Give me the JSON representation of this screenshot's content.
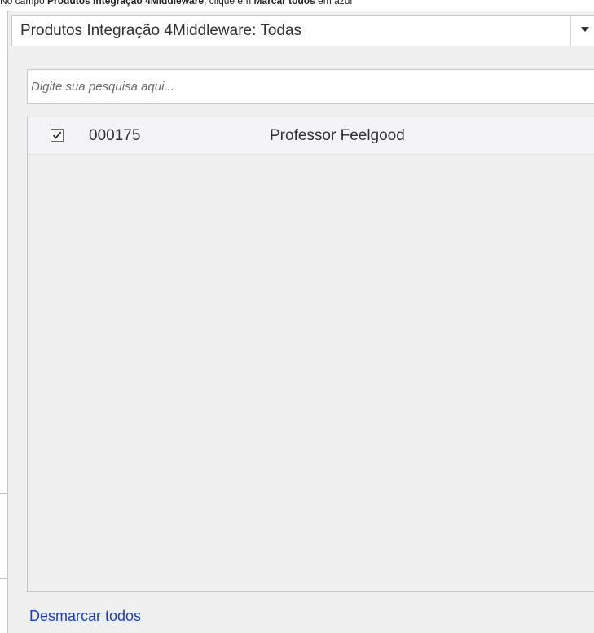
{
  "instruction": {
    "prefix": "No campo ",
    "field_bold": "Produtos Integração 4Middleware",
    "middle": ", clique em ",
    "action_bold": "Marcar todos",
    "suffix": " em azul"
  },
  "filter": {
    "dropdown_label": "Produtos Integração 4Middleware: Todas",
    "search_placeholder": "Digite sua pesquisa aqui...",
    "items": [
      {
        "checked": true,
        "code": "000175",
        "name": "Professor Feelgood"
      }
    ],
    "unselect_all_label": "Desmarcar todos"
  },
  "icons": {
    "dropdown": "chevron-down-icon",
    "check": "checkmark-icon"
  },
  "colors": {
    "link": "#1a3fc4",
    "panel_background": "#f0f0f0"
  }
}
